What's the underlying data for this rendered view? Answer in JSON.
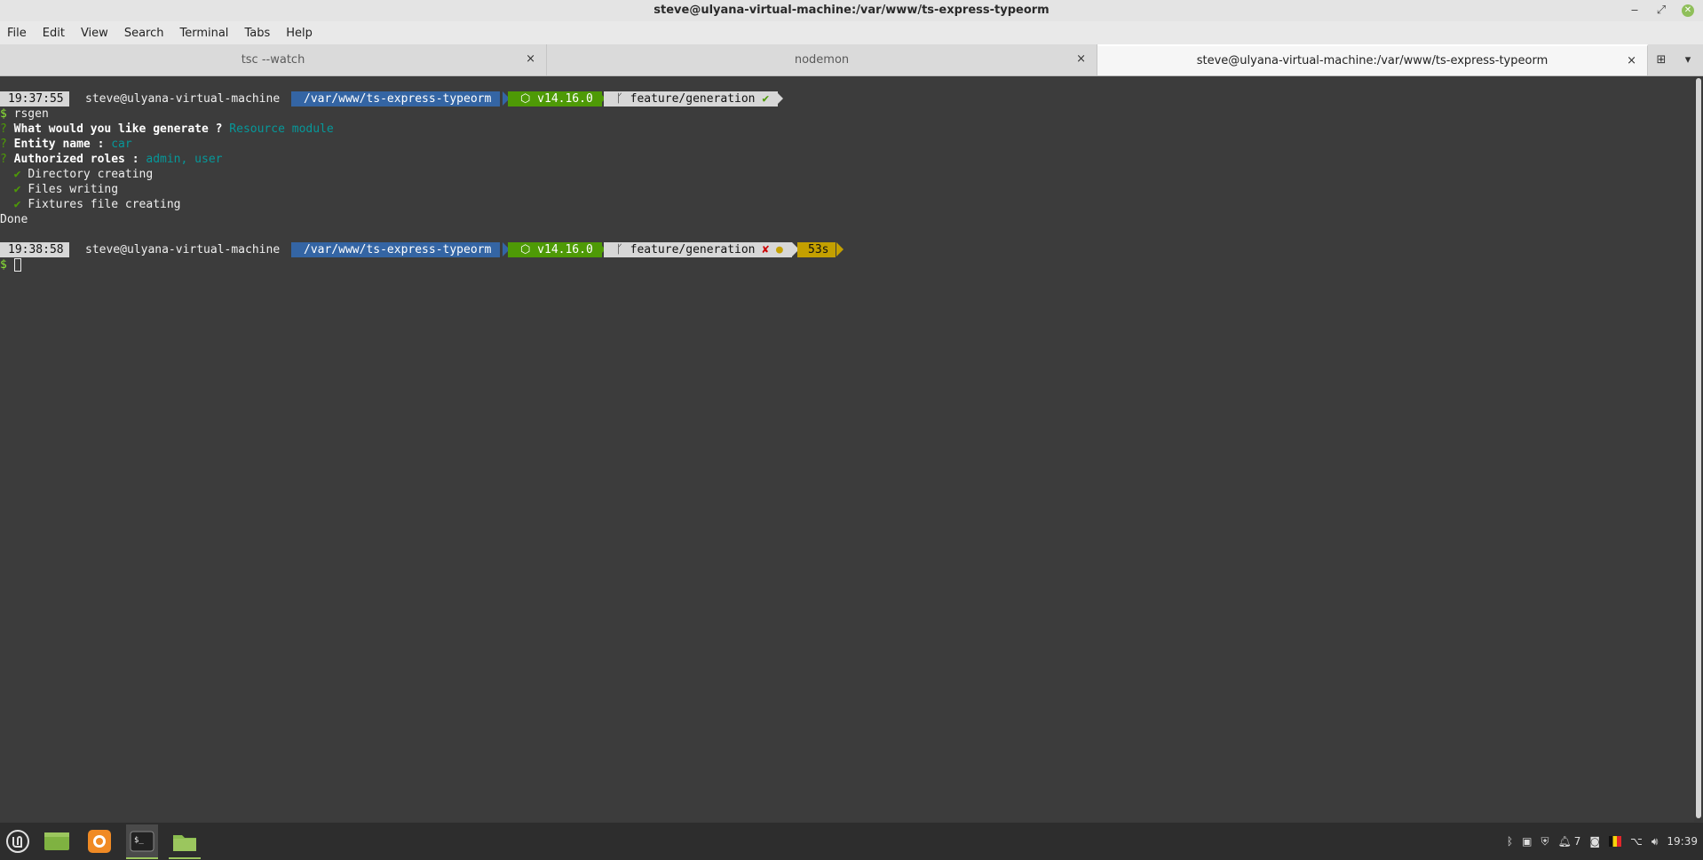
{
  "window": {
    "title": "steve@ulyana-virtual-machine:/var/www/ts-express-typeorm",
    "minimize": "‒",
    "maximize": "⤢",
    "close": "✕"
  },
  "menu": [
    "File",
    "Edit",
    "View",
    "Search",
    "Terminal",
    "Tabs",
    "Help"
  ],
  "tabs": [
    {
      "label": "tsc --watch",
      "close": "×"
    },
    {
      "label": "nodemon",
      "close": "×"
    },
    {
      "label": "steve@ulyana-virtual-machine:/var/www/ts-express-typeorm",
      "close": "×"
    }
  ],
  "tab_actions": {
    "new_tab": "⊞",
    "menu": "▾"
  },
  "prompt1": {
    "time": "19:37:55",
    "user": "steve@ulyana-virtual-machine",
    "dir": "/var/www/ts-express-typeorm",
    "node": "⬡ v14.16.0",
    "git": "ᚴ feature/generation",
    "git_status": "✔"
  },
  "output": {
    "command": "rsgen",
    "dollar": "$",
    "q_mark": "?",
    "q1_label": "What would you like generate ?",
    "q1_answer": "Resource module",
    "q2_label": "Entity name :",
    "q2_answer": "car",
    "q3_label": "Authorized roles :",
    "q3_answer": "admin, user",
    "check": "✔",
    "step1": "Directory creating",
    "step2": "Files writing",
    "step3": "Fixtures file creating",
    "done": "Done"
  },
  "prompt2": {
    "time": "19:38:58",
    "user": "steve@ulyana-virtual-machine",
    "dir": "/var/www/ts-express-typeorm",
    "node": "⬡ v14.16.0",
    "git": "ᚴ feature/generation",
    "git_status": "✘",
    "git_dot": "●",
    "duration": "53s"
  },
  "taskbar": {
    "clock": "19:39",
    "notif_count": "7"
  },
  "colors": {
    "terminal_bg": "#3c3c3c",
    "dir_segment": "#3465a4",
    "node_segment": "#4e9a06",
    "duration_segment": "#c4a000",
    "time_segment": "#d7d7d7"
  }
}
